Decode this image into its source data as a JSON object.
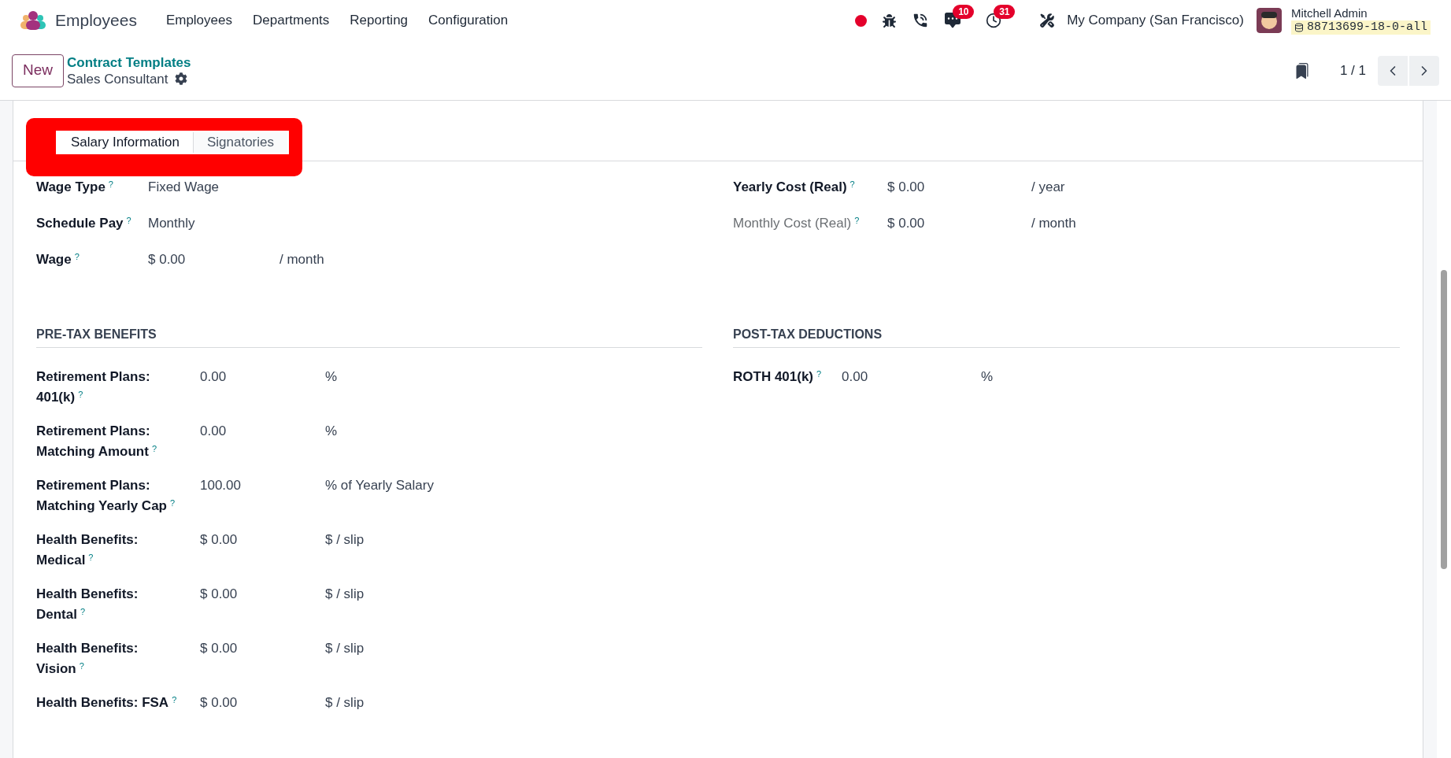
{
  "navbar": {
    "app_name": "Employees",
    "menu": [
      "Employees",
      "Departments",
      "Reporting",
      "Configuration"
    ],
    "messages_count": "10",
    "activities_count": "31",
    "company": "My Company (San Francisco)",
    "user_name": "Mitchell Admin",
    "database": "88713699-18-0-all"
  },
  "control_panel": {
    "new_button": "New",
    "breadcrumb_parent": "Contract Templates",
    "breadcrumb_current": "Sales Consultant",
    "pager": "1 / 1"
  },
  "tabs": [
    {
      "label": "Salary Information",
      "selected": true
    },
    {
      "label": "Signatories",
      "selected": false
    }
  ],
  "main_left": [
    {
      "label": "Wage Type",
      "help": "?",
      "value": "Fixed Wage"
    },
    {
      "label": "Schedule Pay",
      "help": "?",
      "value": "Monthly"
    },
    {
      "label": "Wage",
      "help": "?",
      "value": "$ 0.00",
      "unit": "/ month"
    }
  ],
  "main_right": [
    {
      "label": "Yearly Cost (Real)",
      "help": "?",
      "value": "$ 0.00",
      "unit": "/ year",
      "dimmed": false
    },
    {
      "label": "Monthly Cost (Real)",
      "help": "?",
      "value": "$ 0.00",
      "unit": "/ month",
      "dimmed": true
    }
  ],
  "pre_tax": {
    "title": "PRE-TAX BENEFITS",
    "rows": [
      {
        "label": "Retirement Plans: 401(k)",
        "help": "?",
        "value": "0.00",
        "unit": "%"
      },
      {
        "label": "Retirement Plans: Matching Amount",
        "help": "?",
        "value": "0.00",
        "unit": "%"
      },
      {
        "label": "Retirement Plans: Matching Yearly Cap",
        "help": "?",
        "value": "100.00",
        "unit": "% of Yearly Salary"
      },
      {
        "label": "Health Benefits: Medical",
        "help": "?",
        "value": "$ 0.00",
        "unit": "$ / slip"
      },
      {
        "label": "Health Benefits: Dental",
        "help": "?",
        "value": "$ 0.00",
        "unit": "$ / slip"
      },
      {
        "label": "Health Benefits: Vision",
        "help": "?",
        "value": "$ 0.00",
        "unit": "$ / slip"
      },
      {
        "label": "Health Benefits: FSA",
        "help": "?",
        "value": "$ 0.00",
        "unit": "$ / slip"
      }
    ]
  },
  "post_tax": {
    "title": "POST-TAX DEDUCTIONS",
    "rows": [
      {
        "label": "ROTH 401(k)",
        "help": "?",
        "value": "0.00",
        "unit": "%"
      }
    ]
  }
}
